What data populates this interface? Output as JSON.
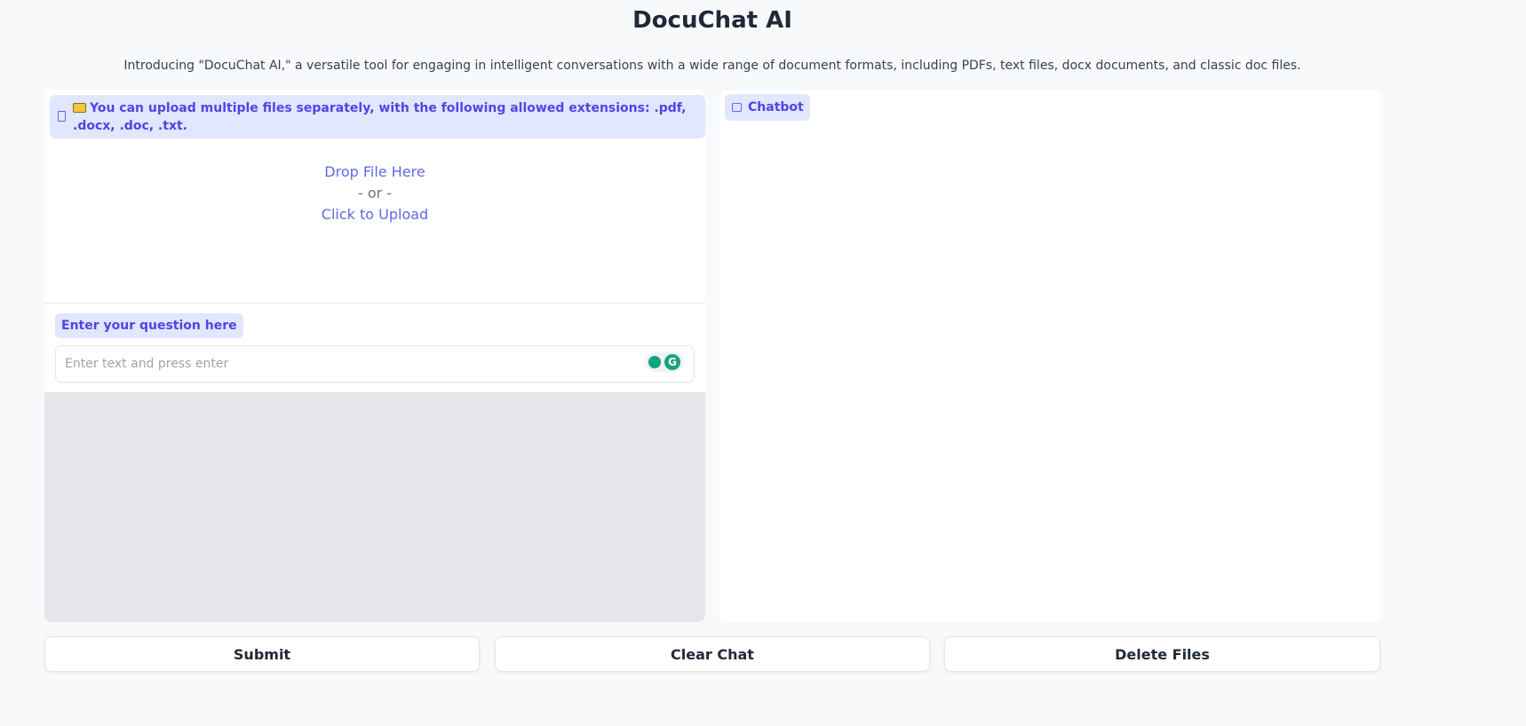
{
  "header": {
    "title": "DocuChat AI",
    "subtitle": "Introducing \"DocuChat AI,\" a versatile tool for engaging in intelligent conversations with a wide range of document formats, including PDFs, text files, docx documents, and classic doc files."
  },
  "upload": {
    "label": "You can upload multiple files separately, with the following allowed extensions: .pdf, .docx, .doc, .txt.",
    "drop_text": "Drop File Here",
    "or_text": "- or -",
    "click_text": "Click to Upload"
  },
  "question": {
    "label": "Enter your question here",
    "placeholder": "Enter text and press enter",
    "value": ""
  },
  "chatbot": {
    "label": "Chatbot"
  },
  "buttons": {
    "submit": "Submit",
    "clear": "Clear Chat",
    "delete": "Delete Files"
  },
  "icons": {
    "file": "file-icon",
    "folder": "folder-icon",
    "chat": "chat-icon",
    "bulb": "lightbulb-icon",
    "grammarly": "grammarly-icon"
  },
  "colors": {
    "accent": "#4f46e5",
    "label_bg": "#e0e7ff",
    "page_bg": "#f8f9fb",
    "output_bg": "#e5e7eb"
  }
}
